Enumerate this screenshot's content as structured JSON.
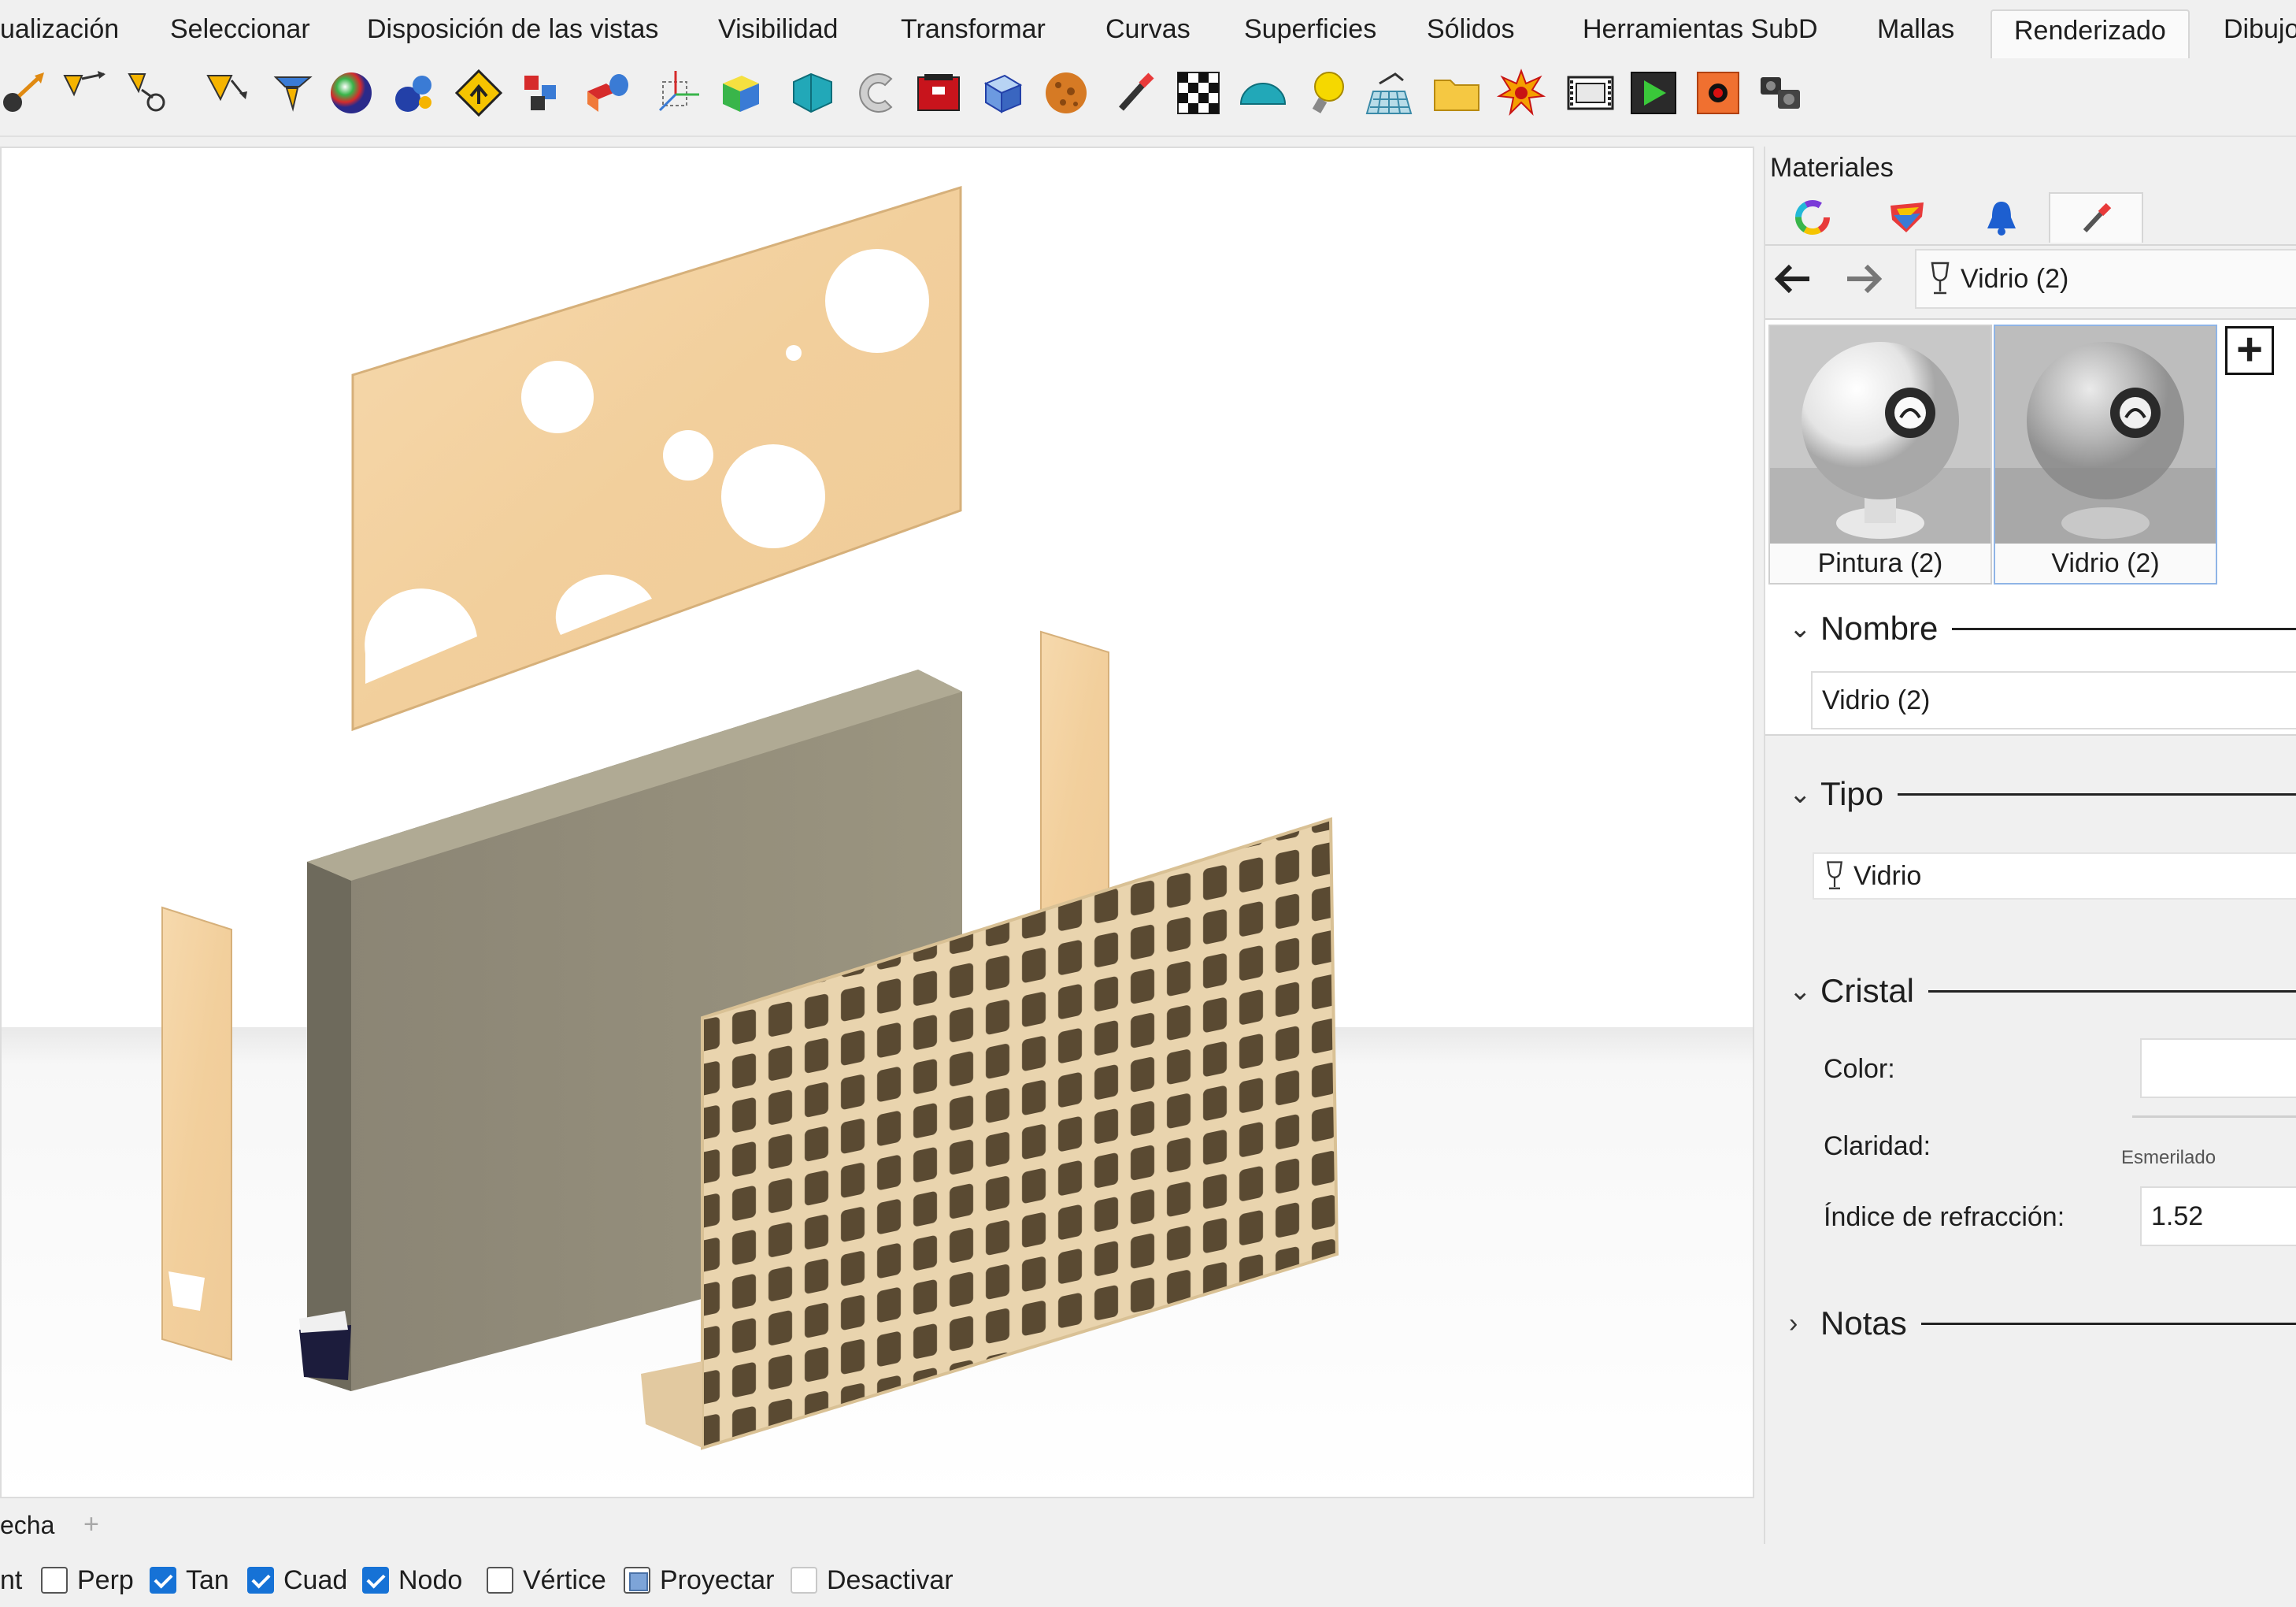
{
  "menu": {
    "tabs": [
      "ualización",
      "Seleccionar",
      "Disposición de las vistas",
      "Visibilidad",
      "Transformar",
      "Curvas",
      "Superficies",
      "Sólidos",
      "Herramientas SubD",
      "Mallas",
      "Renderizado",
      "Dibujo"
    ],
    "active": "Renderizado"
  },
  "toolbar": {
    "icons": [
      "point-arrow-icon",
      "light-arrow-icon",
      "spotlight-icon",
      "directional-light-icon",
      "linear-light-icon",
      "render-sphere-icon",
      "material-balls-icon",
      "warning-sign-icon",
      "sun-icon",
      "environment-icon",
      "gumball-icon",
      "box-mapping-icon",
      "cylinder-map-icon",
      "torus-icon",
      "red-box-icon",
      "glass-cube-icon",
      "texture-ball-icon",
      "paint-brush-icon",
      "checker-icon",
      "ground-plane-icon",
      "bulb-icon",
      "mesh-grid-icon",
      "folder-icon",
      "explosion-icon",
      "film-strip-icon",
      "play-render-icon",
      "record-icon",
      "camera-icon"
    ]
  },
  "viewport": {
    "label": "echa",
    "add_symbol": "+"
  },
  "osnaps": [
    {
      "label": "nt",
      "state": "none"
    },
    {
      "label": "Perp",
      "state": "off"
    },
    {
      "label": "Tan",
      "state": "on"
    },
    {
      "label": "Cuad",
      "state": "on"
    },
    {
      "label": "Nodo",
      "state": "on"
    },
    {
      "label": "Vértice",
      "state": "off"
    },
    {
      "label": "Proyectar",
      "state": "partial"
    },
    {
      "label": "Desactivar",
      "state": "disabled"
    }
  ],
  "panel": {
    "title": "Materiales",
    "tabs": [
      "color-wheel-icon",
      "layers-icon",
      "bell-icon",
      "brush-icon"
    ],
    "breadcrumb": "Vidrio (2)",
    "thumbnails": [
      {
        "caption": "Pintura (2)",
        "selected": false
      },
      {
        "caption": "Vidrio (2)",
        "selected": true
      }
    ],
    "add_symbol": "+",
    "sections": {
      "nombre": {
        "title": "Nombre",
        "value": "Vidrio (2)"
      },
      "tipo": {
        "title": "Tipo",
        "value": "Vidrio"
      },
      "cristal": {
        "title": "Cristal",
        "color_label": "Color:",
        "claridad_label": "Claridad:",
        "esmerilado": "Esmerilado",
        "ior_label": "Índice de refracción:",
        "ior_value": "1.52"
      },
      "notas": {
        "title": "Notas"
      }
    }
  }
}
